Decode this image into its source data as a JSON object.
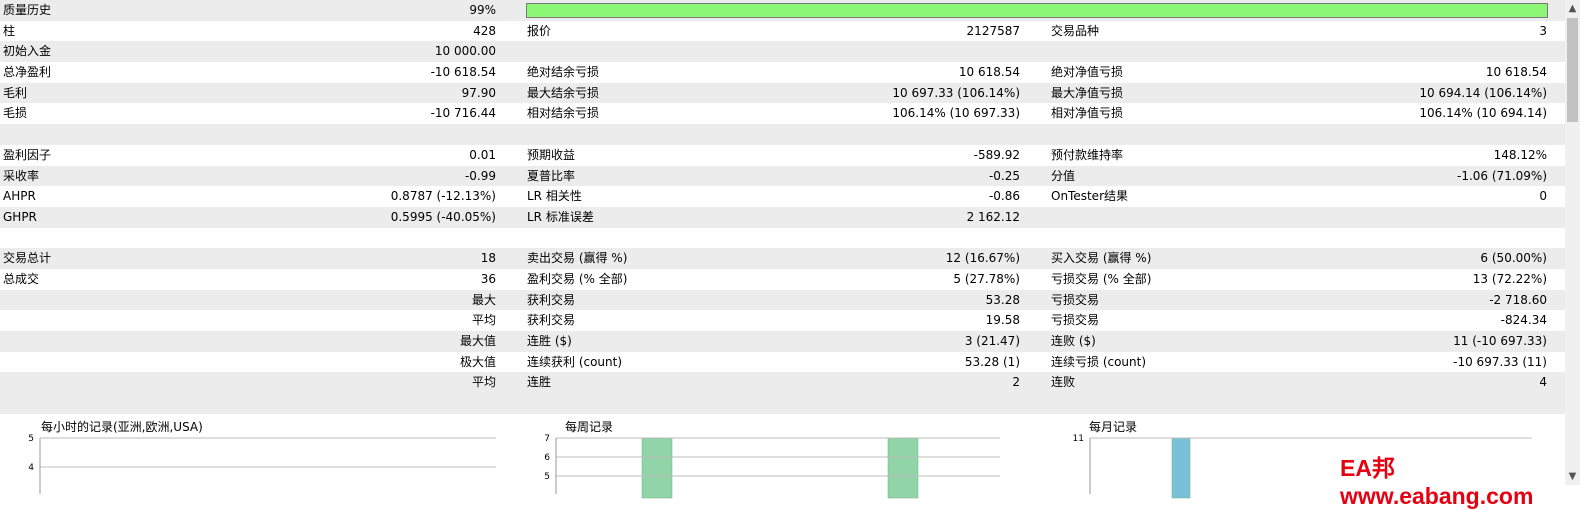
{
  "quality": {
    "label": "质量历史",
    "value": "99%",
    "fraction": 0.99
  },
  "rows": [
    {
      "c1l": "柱",
      "c1v": "428",
      "c2l": "报价",
      "c2v": "2127587",
      "c3l": "交易品种",
      "c3v": "3"
    },
    {
      "c1l": "初始入金",
      "c1v": "10 000.00",
      "c2l": "",
      "c2v": "",
      "c3l": "",
      "c3v": ""
    },
    {
      "c1l": "总净盈利",
      "c1v": "-10 618.54",
      "c2l": "绝对结余亏损",
      "c2v": "10 618.54",
      "c3l": "绝对净值亏损",
      "c3v": "10 618.54"
    },
    {
      "c1l": "毛利",
      "c1v": "97.90",
      "c2l": "最大结余亏损",
      "c2v": "10 697.33 (106.14%)",
      "c3l": "最大净值亏损",
      "c3v": "10 694.14 (106.14%)"
    },
    {
      "c1l": "毛损",
      "c1v": "-10 716.44",
      "c2l": "相对结余亏损",
      "c2v": "106.14% (10 697.33)",
      "c3l": "相对净值亏损",
      "c3v": "106.14% (10 694.14)"
    },
    {
      "c1l": "",
      "c1v": "",
      "c2l": "",
      "c2v": "",
      "c3l": "",
      "c3v": ""
    },
    {
      "c1l": "盈利因子",
      "c1v": "0.01",
      "c2l": "预期收益",
      "c2v": "-589.92",
      "c3l": "预付款维持率",
      "c3v": "148.12%"
    },
    {
      "c1l": "采收率",
      "c1v": "-0.99",
      "c2l": "夏普比率",
      "c2v": "-0.25",
      "c3l": "分值",
      "c3v": "-1.06 (71.09%)"
    },
    {
      "c1l": "AHPR",
      "c1v": "0.8787 (-12.13%)",
      "c2l": "LR 相关性",
      "c2v": "-0.86",
      "c3l": "OnTester结果",
      "c3v": "0"
    },
    {
      "c1l": "GHPR",
      "c1v": "0.5995 (-40.05%)",
      "c2l": "LR 标准误差",
      "c2v": "2 162.12",
      "c3l": "",
      "c3v": ""
    },
    {
      "c1l": "",
      "c1v": "",
      "c2l": "",
      "c2v": "",
      "c3l": "",
      "c3v": ""
    },
    {
      "c1l": "交易总计",
      "c1v": "18",
      "c2l": "卖出交易 (赢得 %)",
      "c2v": "12 (16.67%)",
      "c3l": "买入交易 (赢得 %)",
      "c3v": "6 (50.00%)"
    },
    {
      "c1l": "总成交",
      "c1v": "36",
      "c2l": "盈利交易 (% 全部)",
      "c2v": "5 (27.78%)",
      "c3l": "亏损交易 (% 全部)",
      "c3v": "13 (72.22%)"
    },
    {
      "c1l": "",
      "c1v": "最大",
      "c2l": "获利交易",
      "c2v": "53.28",
      "c3l": "亏损交易",
      "c3v": "-2 718.60"
    },
    {
      "c1l": "",
      "c1v": "平均",
      "c2l": "获利交易",
      "c2v": "19.58",
      "c3l": "亏损交易",
      "c3v": "-824.34"
    },
    {
      "c1l": "",
      "c1v": "最大值",
      "c2l": "连胜 ($)",
      "c2v": "3 (21.47)",
      "c3l": "连败 ($)",
      "c3v": "11 (-10 697.33)"
    },
    {
      "c1l": "",
      "c1v": "极大值",
      "c2l": "连续获利 (count)",
      "c2v": "53.28 (1)",
      "c3l": "连续亏损 (count)",
      "c3v": "-10 697.33 (11)"
    },
    {
      "c1l": "",
      "c1v": "平均",
      "c2l": "连胜",
      "c2v": "2",
      "c3l": "连败",
      "c3v": "4"
    }
  ],
  "chart_data": [
    {
      "type": "bar",
      "title": "每小时的记录(亚洲,欧洲,USA)",
      "yticks": [
        "5",
        "4"
      ],
      "bar_color": "#90d4a8",
      "categories": [],
      "values": []
    },
    {
      "type": "bar",
      "title": "每周记录",
      "yticks": [
        "7",
        "6",
        "5"
      ],
      "bar_color": "#90d4a8",
      "categories": [],
      "values": []
    },
    {
      "type": "bar",
      "title": "每月记录",
      "yticks": [
        "11"
      ],
      "bar_color": "#7ac0d8",
      "categories": [],
      "values": []
    }
  ],
  "scrollbar": {
    "up_icon": "▲",
    "down_icon": "▼"
  },
  "watermark": "EA邦www.eabang.com"
}
